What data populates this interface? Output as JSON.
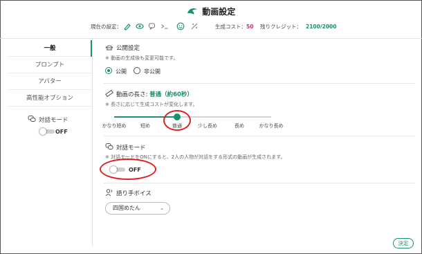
{
  "header": {
    "title": "動画設定",
    "current_settings_label": "現在の設定：",
    "cost_label": "生成コスト：",
    "cost_value": "50",
    "credit_label": "残りクレジット：",
    "credit_value": "2100/2000",
    "icons": [
      "brush-icon",
      "eye-icon",
      "chat-icon",
      "terminal-icon",
      "smile-icon",
      "no-magic-icon"
    ]
  },
  "sidebar": {
    "items": [
      {
        "label": "一般",
        "active": true
      },
      {
        "label": "プロンプト",
        "active": false
      },
      {
        "label": "アバター",
        "active": false
      },
      {
        "label": "高性能オプション",
        "active": false
      }
    ],
    "dialog_mode_label": "対話モード",
    "dialog_toggle_label": "OFF"
  },
  "main": {
    "visibility": {
      "title": "公開設定",
      "note": "※ 動画の生成後も変更可能です。",
      "options": [
        "公開",
        "非公開"
      ],
      "selected": "公開"
    },
    "length": {
      "title": "動画の長さ:",
      "value_text": "普通（約60秒）",
      "note": "※ 長さに応じて生成コストが変化します。",
      "ticks": [
        "かなり短め",
        "短め",
        "普通",
        "少し長め",
        "長め",
        "かなり長め"
      ],
      "selected_index": 2
    },
    "dialog": {
      "title": "対話モード",
      "note": "※ 対話モードをONにすると、2人の人物が対話をする形式の動画が生成されます。",
      "toggle_label": "OFF",
      "on": false
    },
    "narrator": {
      "title": "語り手ボイス",
      "selected": "四国めたん"
    }
  },
  "footer": {
    "submit_label": "決定"
  },
  "colors": {
    "accent": "#1a8f6a",
    "annotation": "#e02020"
  }
}
